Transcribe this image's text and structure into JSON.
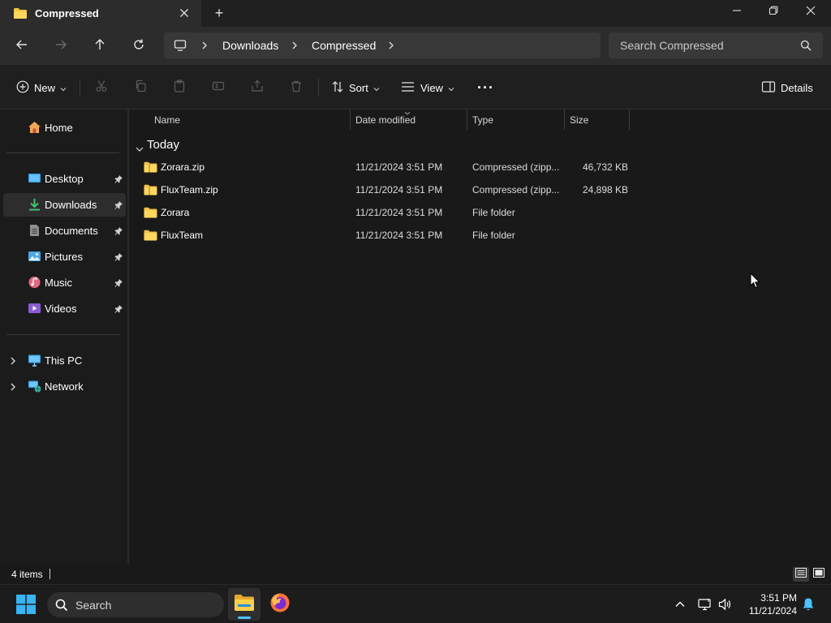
{
  "window": {
    "tab_title": "Compressed",
    "new_tab_symbol": "+"
  },
  "address": {
    "crumbs": [
      "Downloads",
      "Compressed"
    ],
    "search_placeholder": "Search Compressed"
  },
  "commands": {
    "new_label": "New",
    "sort_label": "Sort",
    "view_label": "View",
    "more_symbol": "···",
    "details_label": "Details"
  },
  "sidebar": {
    "home": "Home",
    "items": [
      {
        "label": "Desktop",
        "icon": "desktop-icon"
      },
      {
        "label": "Downloads",
        "icon": "downloads-icon"
      },
      {
        "label": "Documents",
        "icon": "documents-icon"
      },
      {
        "label": "Pictures",
        "icon": "pictures-icon"
      },
      {
        "label": "Music",
        "icon": "music-icon"
      },
      {
        "label": "Videos",
        "icon": "videos-icon"
      }
    ],
    "this_pc": "This PC",
    "network": "Network"
  },
  "columns": {
    "name": "Name",
    "date": "Date modified",
    "type": "Type",
    "size": "Size"
  },
  "group": {
    "label": "Today"
  },
  "files": [
    {
      "name": "Zorara.zip",
      "date": "11/21/2024 3:51 PM",
      "type": "Compressed (zipp...",
      "size": "46,732 KB",
      "icon": "zip-folder-icon"
    },
    {
      "name": "FluxTeam.zip",
      "date": "11/21/2024 3:51 PM",
      "type": "Compressed (zipp...",
      "size": "24,898 KB",
      "icon": "zip-folder-icon"
    },
    {
      "name": "Zorara",
      "date": "11/21/2024 3:51 PM",
      "type": "File folder",
      "size": "",
      "icon": "folder-icon"
    },
    {
      "name": "FluxTeam",
      "date": "11/21/2024 3:51 PM",
      "type": "File folder",
      "size": "",
      "icon": "folder-icon"
    }
  ],
  "status": {
    "item_count": "4 items"
  },
  "taskbar": {
    "search_label": "Search",
    "time": "3:51 PM",
    "date": "11/21/2024"
  },
  "colors": {
    "accent": "#4cc2ff",
    "folder_yellow": "#f4c542",
    "background": "#191919"
  }
}
